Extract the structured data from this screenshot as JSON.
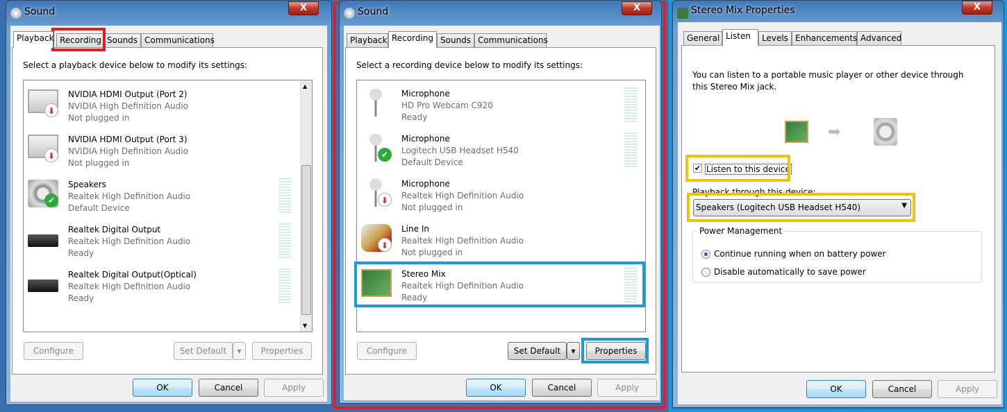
{
  "colors": {
    "highlight_red": "#e01d25",
    "highlight_blue": "#1a9ad9",
    "highlight_yellow": "#f2c300"
  },
  "playback": {
    "title": "Sound",
    "close": "X",
    "tabs": [
      "Playback",
      "Recording",
      "Sounds",
      "Communications"
    ],
    "instruction": "Select a playback device below to modify its settings:",
    "devices": [
      {
        "name": "NVIDIA High Definition Audio",
        "desc": "Not plugged in",
        "status": "",
        "icon": "monitor-icon",
        "badge": "unplugged"
      },
      {
        "name": "NVIDIA HDMI Output (Port 2)",
        "desc": "NVIDIA High Definition Audio",
        "status": "Not plugged in",
        "icon": "monitor-icon",
        "badge": "unplugged"
      },
      {
        "name": "NVIDIA HDMI Output (Port 3)",
        "desc": "NVIDIA High Definition Audio",
        "status": "Not plugged in",
        "icon": "monitor-icon",
        "badge": "unplugged"
      },
      {
        "name": "Speakers",
        "desc": "Realtek High Definition Audio",
        "status": "Default Device",
        "icon": "speaker-icon",
        "badge": "default",
        "meter": true
      },
      {
        "name": "Realtek Digital Output",
        "desc": "Realtek High Definition Audio",
        "status": "Ready",
        "icon": "receiver-icon",
        "meter": true
      },
      {
        "name": "Realtek Digital Output(Optical)",
        "desc": "Realtek High Definition Audio",
        "status": "Ready",
        "icon": "receiver-icon",
        "meter": true
      }
    ],
    "buttons": {
      "configure": "Configure",
      "set_default": "Set Default",
      "properties": "Properties",
      "ok": "OK",
      "cancel": "Cancel",
      "apply": "Apply"
    }
  },
  "recording": {
    "title": "Sound",
    "close": "X",
    "tabs": [
      "Playback",
      "Recording",
      "Sounds",
      "Communications"
    ],
    "instruction": "Select a recording device below to modify its settings:",
    "devices": [
      {
        "name": "Microphone",
        "desc": "HD Pro Webcam C920",
        "status": "Ready",
        "icon": "microphone-icon",
        "meter": true
      },
      {
        "name": "Microphone",
        "desc": "Logitech USB Headset H540",
        "status": "Default Device",
        "icon": "microphone-icon",
        "badge": "default",
        "meter": true
      },
      {
        "name": "Microphone",
        "desc": "Realtek High Definition Audio",
        "status": "Not plugged in",
        "icon": "microphone-icon",
        "badge": "unplugged"
      },
      {
        "name": "Line In",
        "desc": "Realtek High Definition Audio",
        "status": "Not plugged in",
        "icon": "line-in-cable-icon",
        "badge": "unplugged"
      },
      {
        "name": "Stereo Mix",
        "desc": "Realtek High Definition Audio",
        "status": "Ready",
        "icon": "sound-card-icon",
        "meter": true
      }
    ],
    "buttons": {
      "configure": "Configure",
      "set_default": "Set Default",
      "properties": "Properties",
      "ok": "OK",
      "cancel": "Cancel",
      "apply": "Apply"
    }
  },
  "properties": {
    "title": "Stereo Mix Properties",
    "close": "X",
    "tabs": [
      "General",
      "Listen",
      "Levels",
      "Enhancements",
      "Advanced"
    ],
    "description": "You can listen to a portable music player or other device through this Stereo Mix jack.",
    "listen_checkbox": "Listen to this device",
    "listen_checked": true,
    "playback_label": "Playback through this device:",
    "playback_device": "Speakers (Logitech USB Headset H540)",
    "power_group": "Power Management",
    "radio_continue": "Continue running when on battery power",
    "radio_disable": "Disable automatically to save power",
    "radio_selected": "continue",
    "buttons": {
      "ok": "OK",
      "cancel": "Cancel",
      "apply": "Apply"
    }
  }
}
